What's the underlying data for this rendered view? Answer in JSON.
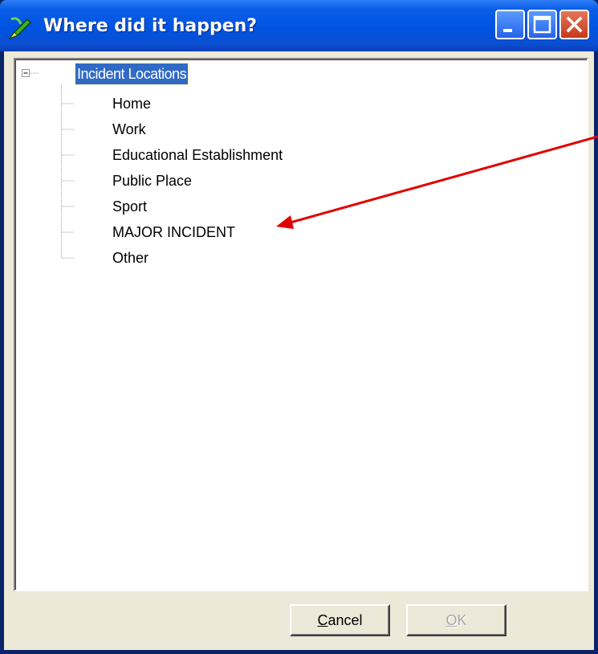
{
  "window": {
    "title": "Where did it happen?",
    "title_icon": "pen-icon",
    "controls": [
      "minimize",
      "maximize",
      "close"
    ]
  },
  "tree": {
    "root": {
      "label": "Incident Locations",
      "expanded": true,
      "selected": true
    },
    "children": [
      {
        "label": "Home"
      },
      {
        "label": "Work"
      },
      {
        "label": "Educational Establishment"
      },
      {
        "label": "Public Place"
      },
      {
        "label": "Sport"
      },
      {
        "label": "MAJOR INCIDENT",
        "highlighted": true
      },
      {
        "label": "Other"
      }
    ]
  },
  "buttons": {
    "cancel": {
      "label": "Cancel",
      "accelerator": "C",
      "enabled": true
    },
    "ok": {
      "label": "OK",
      "accelerator": "O",
      "enabled": false
    }
  },
  "colors": {
    "title_bar": "#0053e0",
    "selection": "#316ac5",
    "annotation_arrow": "#e00000",
    "dialog_face": "#ece9d8"
  }
}
